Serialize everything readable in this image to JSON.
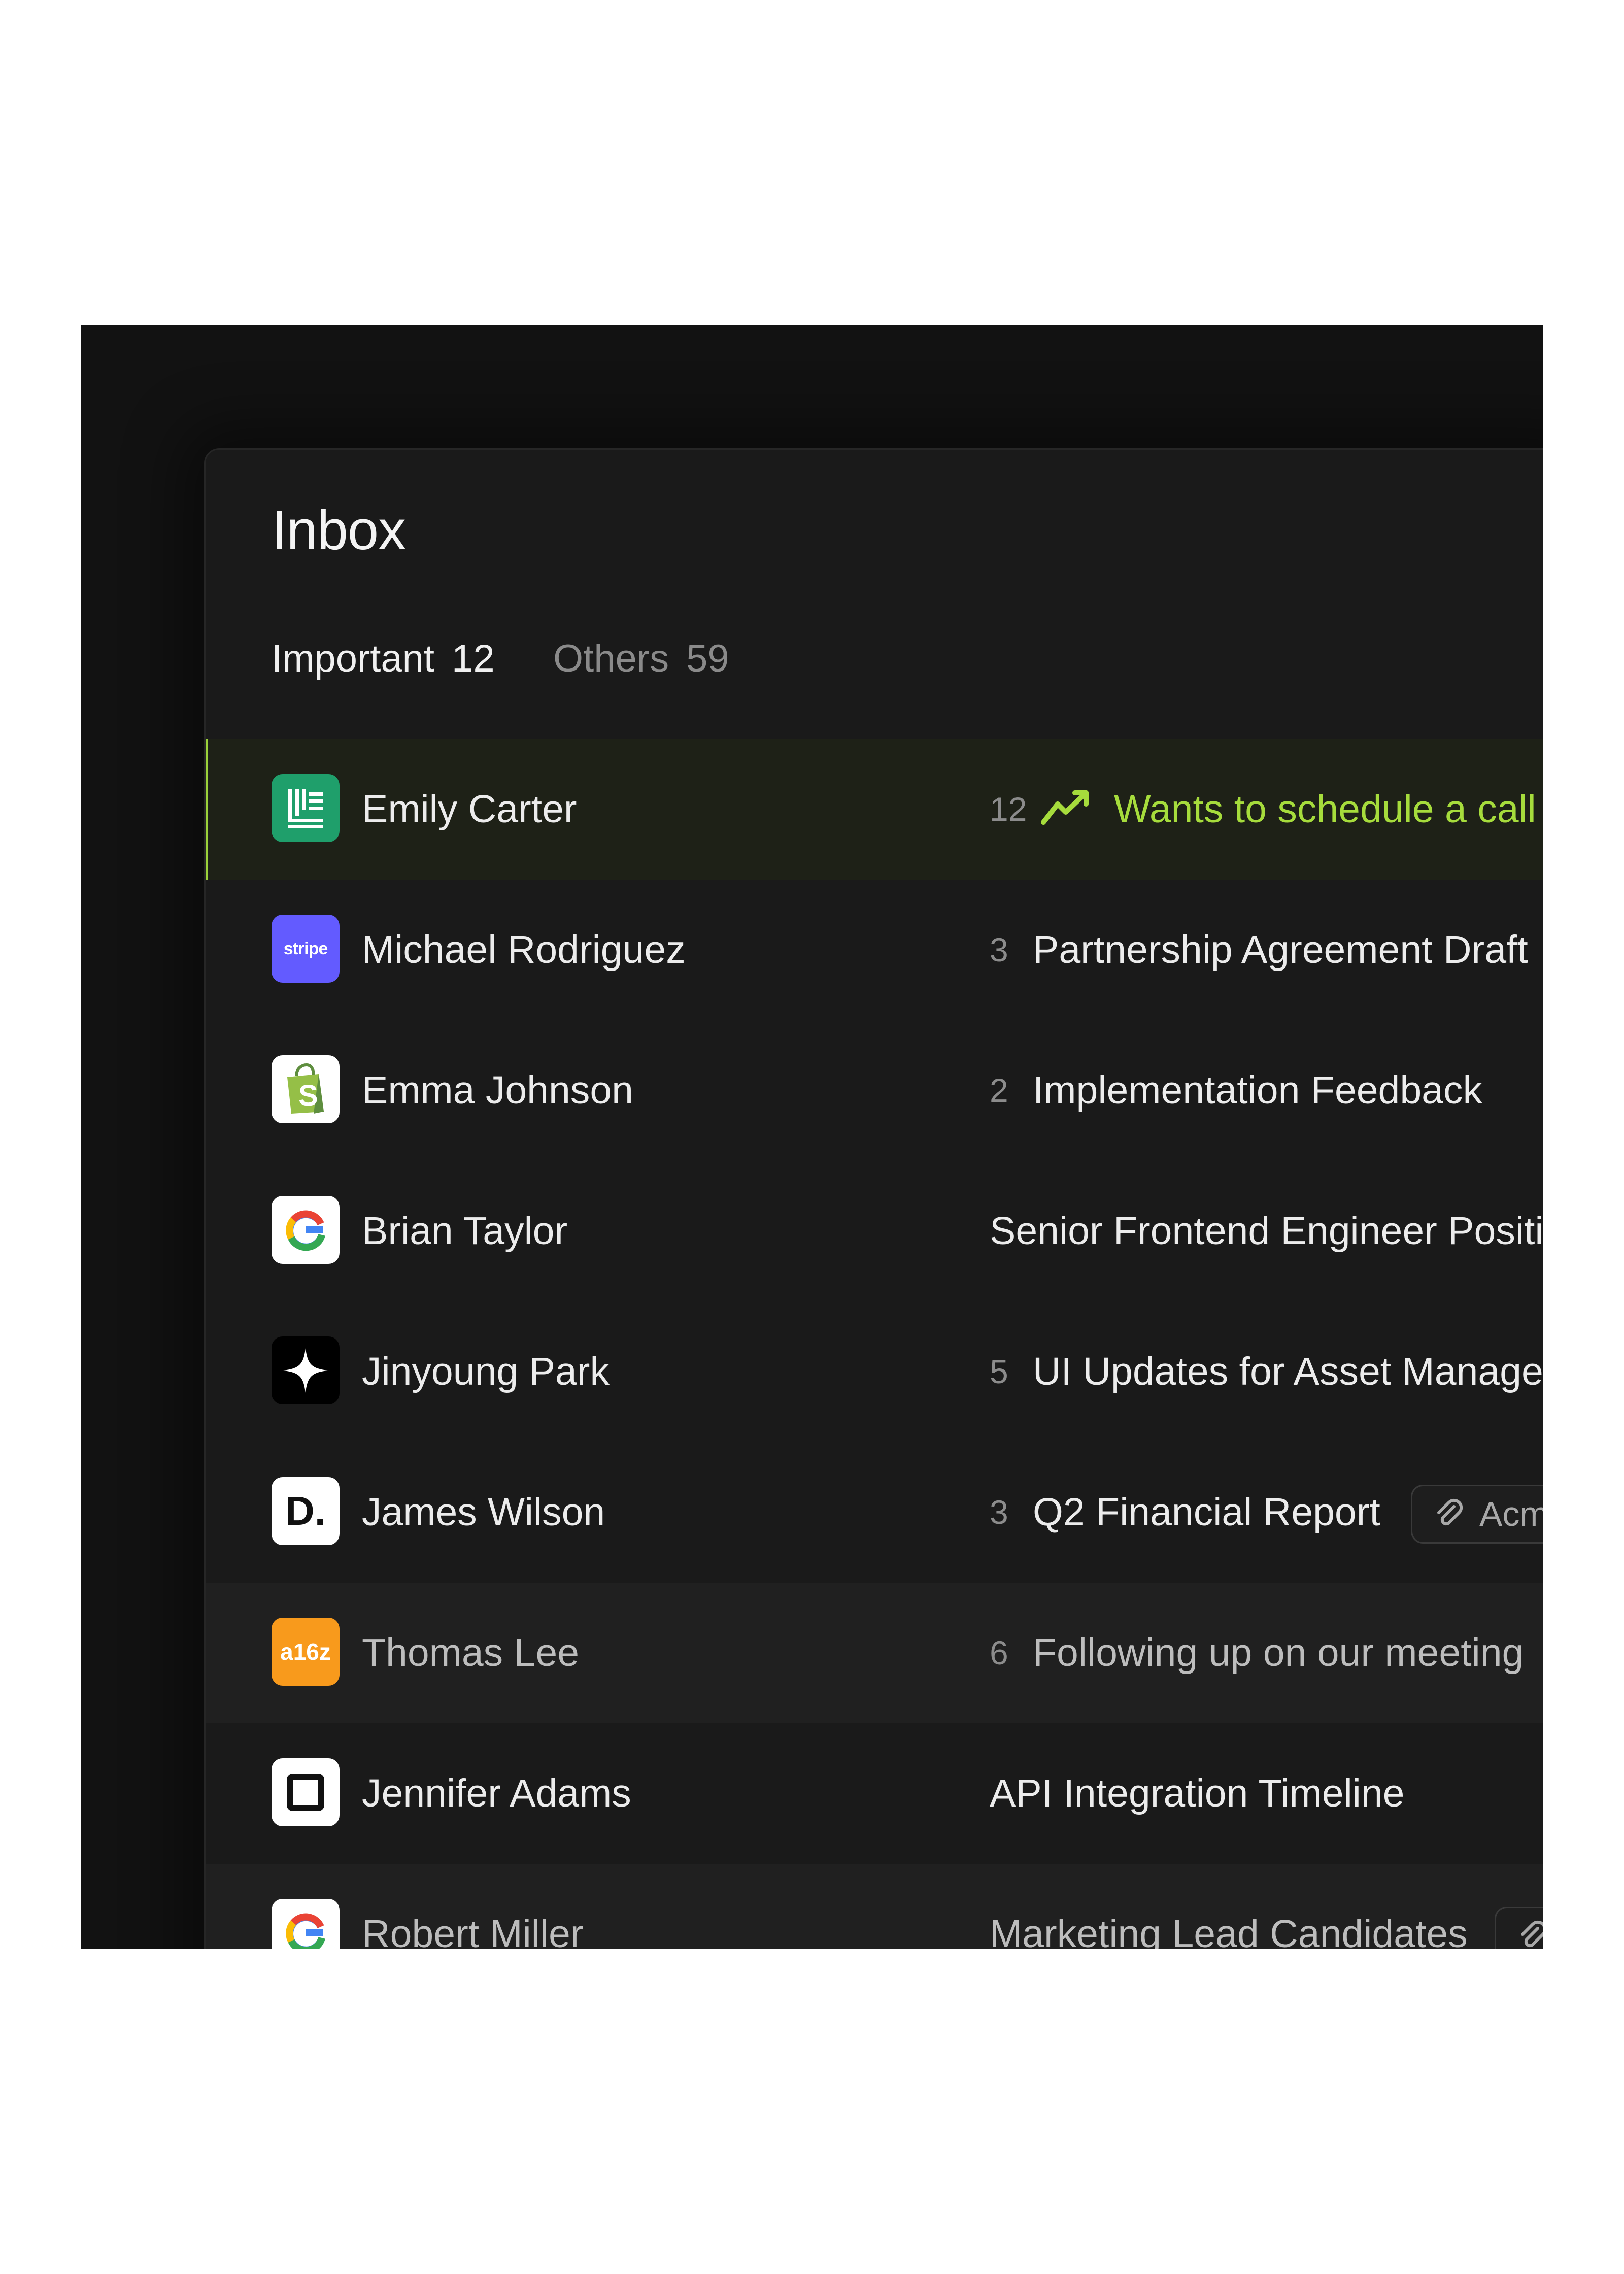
{
  "inbox": {
    "title": "Inbox",
    "tabs": [
      {
        "label": "Important",
        "count": "12"
      },
      {
        "label": "Others",
        "count": "59"
      }
    ],
    "rows": [
      {
        "name": "Emily Carter",
        "count": "12",
        "subject": "Wants to schedule a call",
        "icon": "sparkline-icon",
        "logo": "brand-green-icon"
      },
      {
        "name": "Michael Rodriguez",
        "count": "3",
        "subject": "Partnership Agreement Draft",
        "logo_text": "stripe"
      },
      {
        "name": "Emma Johnson",
        "count": "2",
        "subject": "Implementation Feedback",
        "logo": "shopify-bag-icon"
      },
      {
        "name": "Brian Taylor",
        "count": "",
        "subject": "Senior Frontend Engineer Positio",
        "logo": "google-g-icon"
      },
      {
        "name": "Jinyoung Park",
        "count": "5",
        "subject": "UI Updates for Asset Managem",
        "logo": "sparkle-star-icon"
      },
      {
        "name": "James Wilson",
        "count": "3",
        "subject": "Q2 Financial Report",
        "attachment": "Acme",
        "logo_text": "D."
      },
      {
        "name": "Thomas Lee",
        "count": "6",
        "subject": "Following up on our meeting",
        "logo_text": "a16z"
      },
      {
        "name": "Jennifer Adams",
        "count": "",
        "subject": "API Integration Timeline",
        "logo": "square-outline-icon"
      },
      {
        "name": "Robert Miller",
        "count": "",
        "subject": "Marketing Lead Candidates",
        "logo": "google-g-icon"
      }
    ]
  },
  "colors": {
    "accent_green": "#a6dc3c",
    "background": "#1a1a1a",
    "stripe_purple": "#635bff",
    "a16z_orange": "#f89a1c",
    "brand_green": "#1f9f6b"
  }
}
